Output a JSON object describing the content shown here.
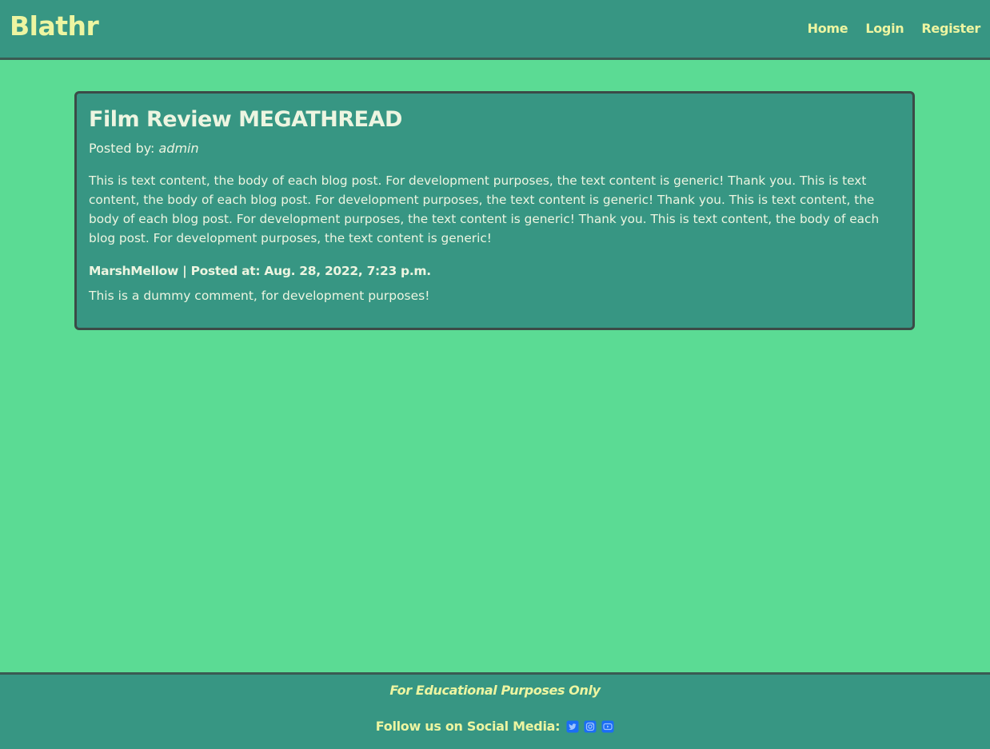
{
  "navbar": {
    "brand": "Blathr",
    "links": [
      {
        "label": "Home"
      },
      {
        "label": "Login"
      },
      {
        "label": "Register"
      }
    ]
  },
  "post": {
    "title": "Film Review MEGATHREAD",
    "posted_by_label": "Posted by: ",
    "author": "admin",
    "body": "This is text content, the body of each blog post. For development purposes, the text content is generic! Thank you. This is text content, the body of each blog post. For development purposes, the text content is generic! Thank you. This is text content, the body of each blog post. For development purposes, the text content is generic! Thank you. This is text content, the body of each blog post. For development purposes, the text content is generic!",
    "comments": [
      {
        "meta": "MarshMellow | Posted at: Aug. 28, 2022, 7:23 p.m.",
        "body": "This is a dummy comment, for development purposes!"
      }
    ]
  },
  "footer": {
    "note": "For Educational Purposes Only",
    "social_label": "Follow us on Social Media:",
    "social_icons": [
      "twitter-icon",
      "instagram-icon",
      "youtube-icon"
    ],
    "icon_color": "#1b6df5"
  },
  "colors": {
    "background": "#5bdb94",
    "panel": "#379683",
    "accent_text": "#edf5a1",
    "border": "#3b4a47"
  }
}
